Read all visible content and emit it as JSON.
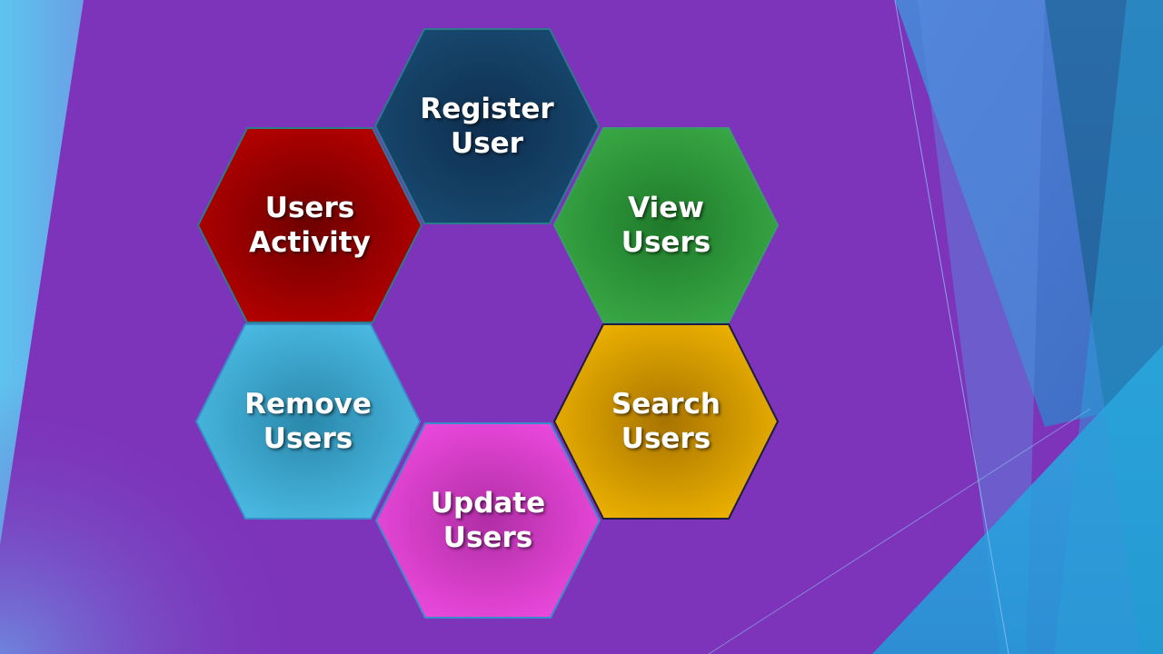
{
  "slide": {
    "background_color": "#7d33ba"
  },
  "hexagons": [
    {
      "id": "register-user",
      "line1": "Register",
      "line2": "User",
      "color": "#123a5c",
      "edge": "#0a2238"
    },
    {
      "id": "view-users",
      "line1": "View",
      "line2": "Users",
      "color": "#2e9c3c",
      "edge": "#1a6e26"
    },
    {
      "id": "search-users",
      "line1": "Search",
      "line2": "Users",
      "color": "#e8a800",
      "edge": "#b07800"
    },
    {
      "id": "update-users",
      "line1": "Update",
      "line2": "Users",
      "color": "#e844d8",
      "edge": "#b82aa8"
    },
    {
      "id": "remove-users",
      "line1": "Remove",
      "line2": "Users",
      "color": "#45b4dc",
      "edge": "#2a86ac"
    },
    {
      "id": "users-activity",
      "line1": "Users",
      "line2": "Activity",
      "color": "#b00000",
      "edge": "#7a0000"
    }
  ]
}
